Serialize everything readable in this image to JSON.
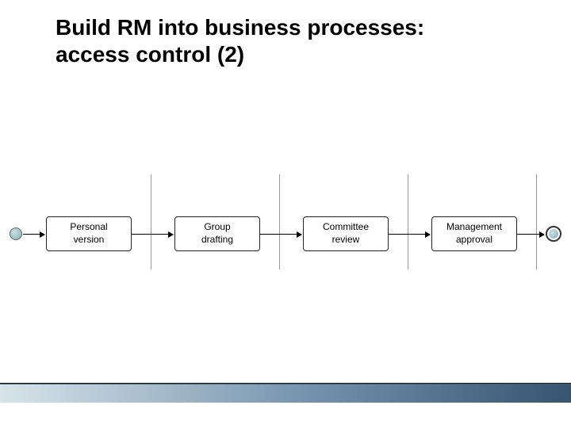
{
  "title_line1": "Build RM into business processes:",
  "title_line2": "access control (2)",
  "flow": {
    "steps": [
      {
        "label": "Personal\nversion"
      },
      {
        "label": "Group\ndrafting"
      },
      {
        "label": "Committee\nreview"
      },
      {
        "label": "Management\napproval"
      }
    ]
  },
  "colors": {
    "node_fill": "#97bdc1",
    "footer_gradient_start": "#d8e4ea",
    "footer_gradient_end": "#36556f"
  },
  "chart_data": {
    "type": "diagram",
    "title": "Build RM into business processes: access control (2)",
    "flow_type": "BPMN process flow",
    "start_event": true,
    "end_event": true,
    "tasks": [
      "Personal version",
      "Group drafting",
      "Committee review",
      "Management approval"
    ],
    "sequence": [
      "start -> Personal version",
      "Personal version -> Group drafting",
      "Group drafting -> Committee review",
      "Committee review -> Management approval",
      "Management approval -> end"
    ],
    "lanes_visible": 4
  }
}
